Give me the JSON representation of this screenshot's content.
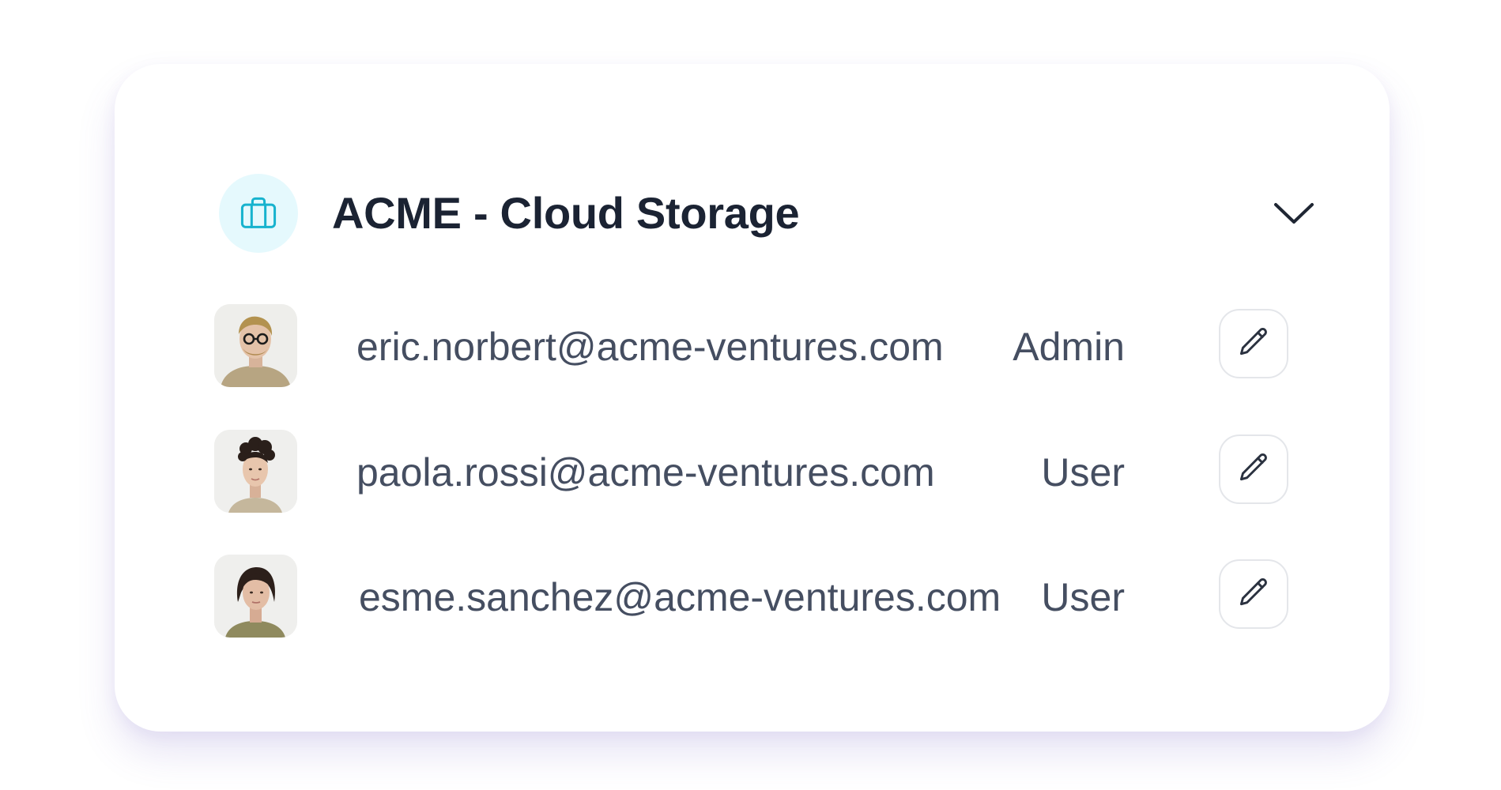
{
  "group": {
    "title": "ACME - Cloud Storage",
    "icon": "briefcase-icon",
    "accent": "#06b6d4",
    "toggle_icon": "chevron-down-icon"
  },
  "members": [
    {
      "email": "eric.norbert@acme-ventures.com",
      "role": "Admin",
      "avatar": "avatar-photo"
    },
    {
      "email": "paola.rossi@acme-ventures.com",
      "role": "User",
      "avatar": "avatar-photo"
    },
    {
      "email": "esme.sanchez@acme-ventures.com",
      "role": "User",
      "avatar": "avatar-photo"
    }
  ],
  "action_icon": "pencil-icon"
}
